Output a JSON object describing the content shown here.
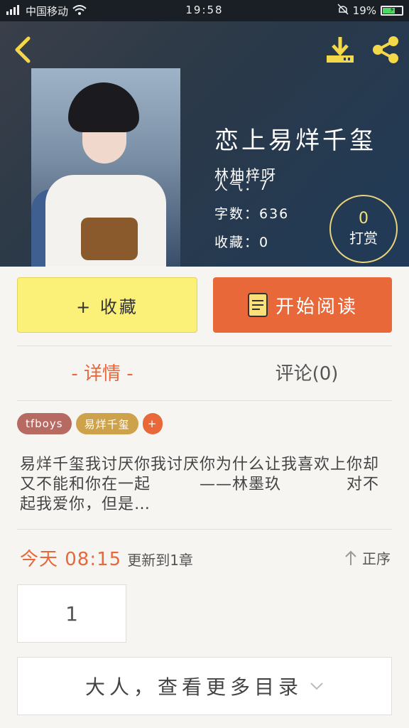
{
  "status_bar": {
    "carrier": "中国移动",
    "time": "19:58",
    "battery": "19%"
  },
  "book": {
    "title": "恋上易烊千玺",
    "author": "林柚梓呀",
    "popularity": "人气：7",
    "word_count": "字数：636",
    "favorites": "收藏：0",
    "reward_count": "0",
    "reward_label": "打赏"
  },
  "actions": {
    "favorite_label": "+ 收藏",
    "read_label": "开始阅读"
  },
  "tabs": [
    {
      "label": "- 详情 -",
      "active": true
    },
    {
      "label": "评论(0)",
      "active": false
    }
  ],
  "tags": [
    "tfboys",
    "易烊千玺",
    "+"
  ],
  "synopsis": "易烊千玺我讨厌你我讨厌你为什么让我喜欢上你却又不能和你在一起　　　——林墨玖　　　　对不起我爱你，但是…",
  "update": {
    "when": "今天 08:15",
    "text": "更新到1章",
    "sort_label": "正序"
  },
  "chapters": [
    "1"
  ],
  "more_catalog_label": "大人，查看更多目录",
  "colors": {
    "accent": "#e8683a",
    "favorite_button": "#fbf078",
    "reward_ring": "#e8d27a"
  }
}
